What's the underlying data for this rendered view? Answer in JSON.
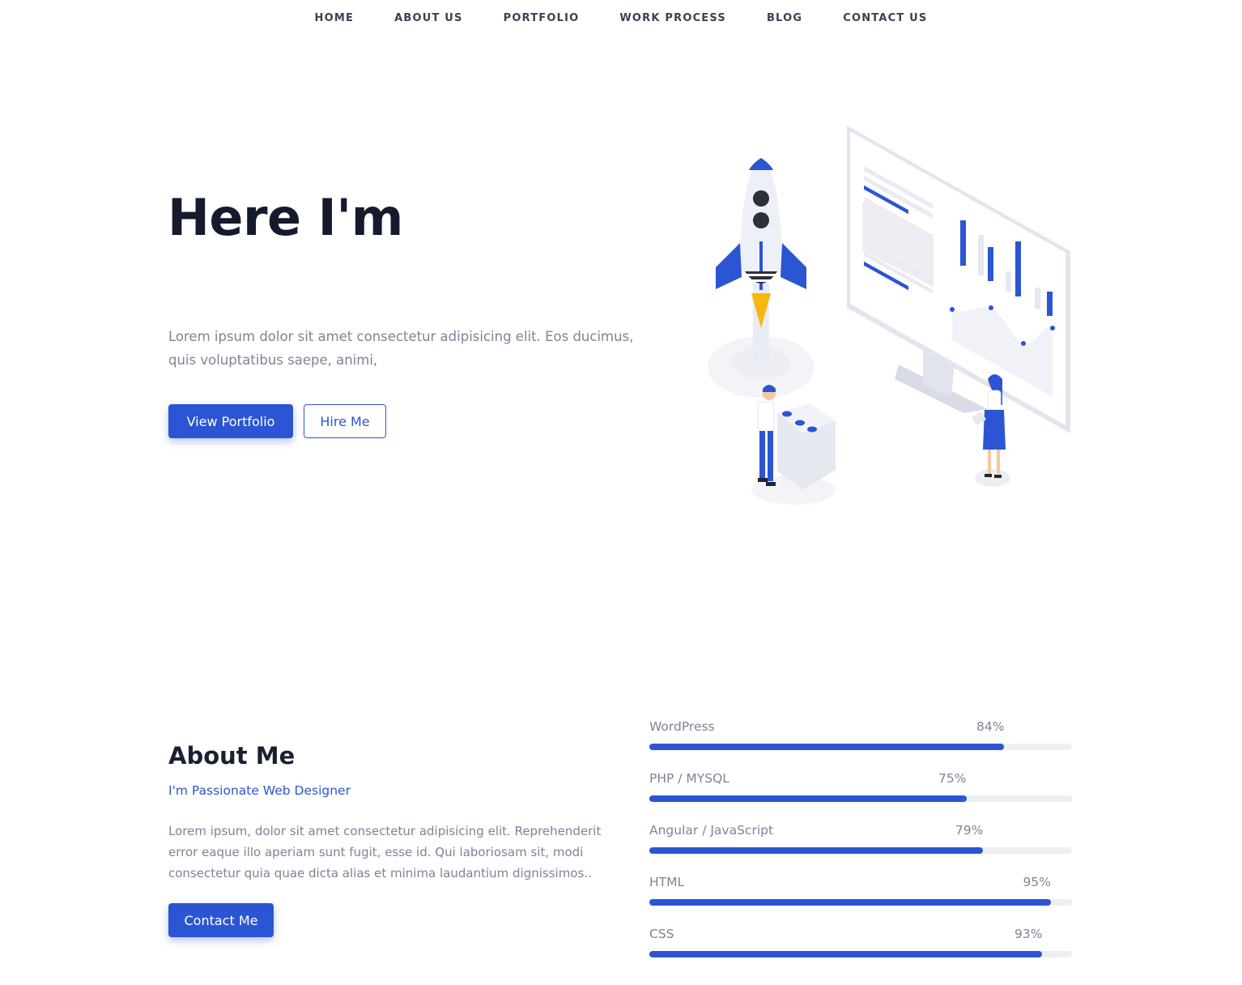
{
  "nav": {
    "items": [
      "HOME",
      "ABOUT US",
      "PORTFOLIO",
      "WORK PROCESS",
      "BLOG",
      "CONTACT US"
    ]
  },
  "hero": {
    "title": "Here I'm",
    "text": "Lorem ipsum dolor sit amet consectetur adipisicing elit. Eos ducimus, quis voluptatibus saepe, animi,",
    "primary_button": "View Portfolio",
    "secondary_button": "Hire Me"
  },
  "about": {
    "title": "About Me",
    "subtitle": "I'm Passionate Web Designer",
    "text": "Lorem ipsum, dolor sit amet consectetur adipisicing elit. Reprehenderit error eaque illo aperiam sunt fugit, esse id. Qui laboriosam sit, modi consectetur quia quae dicta alias et minima laudantium dignissimos..",
    "button": "Contact Me"
  },
  "skills": [
    {
      "name": "WordPress",
      "percent_label": "84%",
      "value": 84
    },
    {
      "name": "PHP / MYSQL",
      "percent_label": "75%",
      "value": 75
    },
    {
      "name": "Angular / JavaScript",
      "percent_label": "79%",
      "value": 79
    },
    {
      "name": "HTML",
      "percent_label": "95%",
      "value": 95
    },
    {
      "name": "CSS",
      "percent_label": "93%",
      "value": 93
    }
  ],
  "colors": {
    "accent": "#2c55d4",
    "track": "#eceff3",
    "heading": "#151b2d",
    "muted": "#7d8496"
  },
  "illustration": {
    "icons": [
      "rocket-icon",
      "monitor-chart-icon",
      "person-icon"
    ]
  }
}
